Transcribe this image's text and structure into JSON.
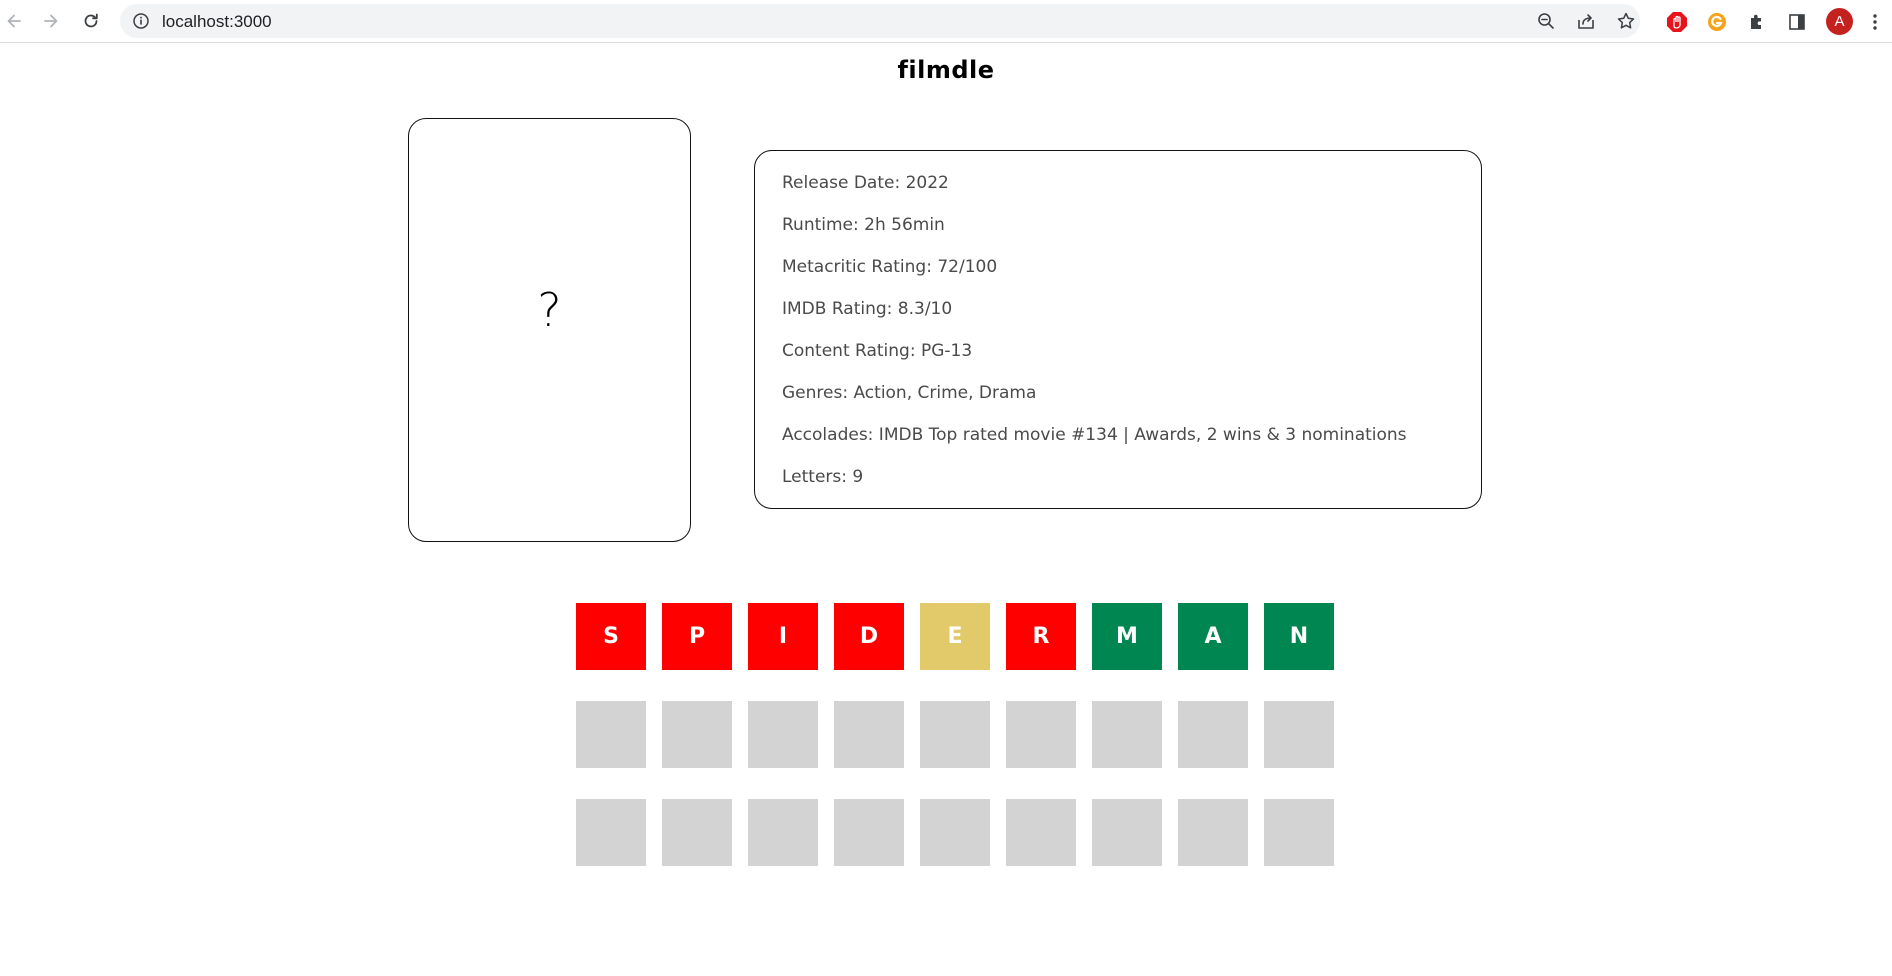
{
  "browser": {
    "url": "localhost:3000",
    "avatar_letter": "A"
  },
  "page": {
    "title": "filmdle",
    "poster_placeholder": "?"
  },
  "info": {
    "lines": [
      "Release Date: 2022",
      "Runtime: 2h 56min",
      "Metacritic Rating: 72/100",
      "IMDB Rating: 8.3/10",
      "Content Rating: PG-13",
      "Genres: Action, Crime, Drama",
      "Accolades: IMDB Top rated movie #134 | Awards, 2 wins & 3 nominations",
      "Letters: 9"
    ]
  },
  "colors": {
    "wrong": "#ff0000",
    "misplaced": "#e2c96a",
    "correct": "#008751",
    "empty": "#d3d3d3"
  },
  "guesses": [
    [
      {
        "letter": "S",
        "state": "wrong"
      },
      {
        "letter": "P",
        "state": "wrong"
      },
      {
        "letter": "I",
        "state": "wrong"
      },
      {
        "letter": "D",
        "state": "wrong"
      },
      {
        "letter": "E",
        "state": "misplaced"
      },
      {
        "letter": "R",
        "state": "wrong"
      },
      {
        "letter": "M",
        "state": "correct"
      },
      {
        "letter": "A",
        "state": "correct"
      },
      {
        "letter": "N",
        "state": "correct"
      }
    ],
    [
      {
        "letter": "",
        "state": "empty"
      },
      {
        "letter": "",
        "state": "empty"
      },
      {
        "letter": "",
        "state": "empty"
      },
      {
        "letter": "",
        "state": "empty"
      },
      {
        "letter": "",
        "state": "empty"
      },
      {
        "letter": "",
        "state": "empty"
      },
      {
        "letter": "",
        "state": "empty"
      },
      {
        "letter": "",
        "state": "empty"
      },
      {
        "letter": "",
        "state": "empty"
      }
    ],
    [
      {
        "letter": "",
        "state": "empty"
      },
      {
        "letter": "",
        "state": "empty"
      },
      {
        "letter": "",
        "state": "empty"
      },
      {
        "letter": "",
        "state": "empty"
      },
      {
        "letter": "",
        "state": "empty"
      },
      {
        "letter": "",
        "state": "empty"
      },
      {
        "letter": "",
        "state": "empty"
      },
      {
        "letter": "",
        "state": "empty"
      },
      {
        "letter": "",
        "state": "empty"
      }
    ]
  ]
}
